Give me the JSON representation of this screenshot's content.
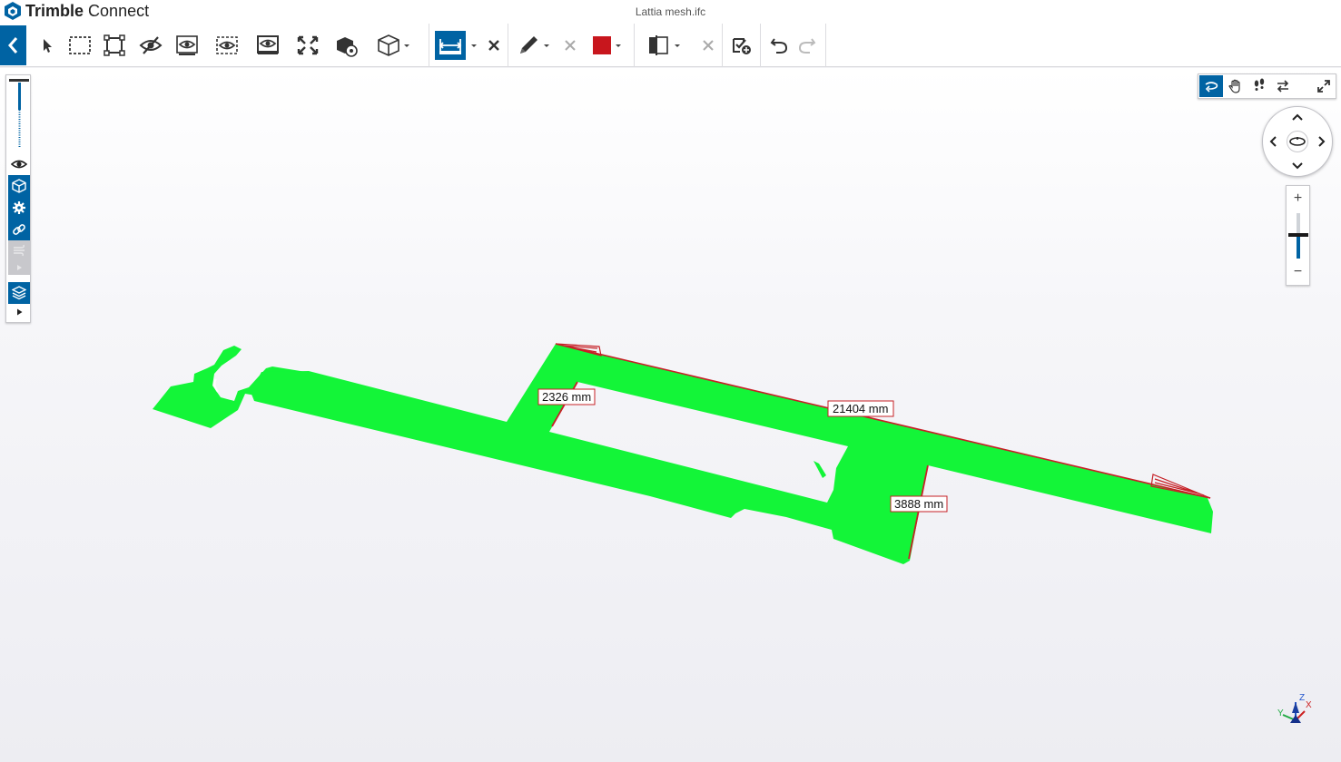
{
  "app": {
    "brand": "Trimble",
    "product": "Connect",
    "file_title": "Lattia mesh.ifc"
  },
  "colors": {
    "accent": "#0063a3",
    "mesh": "#13f538",
    "measure": "#c62026",
    "swatch": "#c8161d"
  },
  "toolbar": {
    "tools": [
      "back-icon",
      "select-icon",
      "box-select-icon",
      "fit-selection-icon",
      "hide-icon",
      "isolate-icon",
      "show-icon",
      "show-all-icon",
      "fit-all-icon",
      "object-settings-icon",
      "view-cube-icon",
      "measure-icon",
      "measure-clear-icon",
      "markup-pen-icon",
      "markup-clear-icon",
      "color-swatch",
      "section-plane-icon",
      "section-clear-icon",
      "zoom-selected-icon",
      "undo-icon",
      "redo-icon"
    ]
  },
  "measurements": [
    {
      "label": "2326 mm"
    },
    {
      "label": "21404 mm"
    },
    {
      "label": "3888 mm"
    }
  ],
  "axes": {
    "x": "X",
    "y": "Y",
    "z": "Z"
  },
  "zoom": {
    "plus": "+",
    "minus": "−",
    "level": 0.35
  }
}
